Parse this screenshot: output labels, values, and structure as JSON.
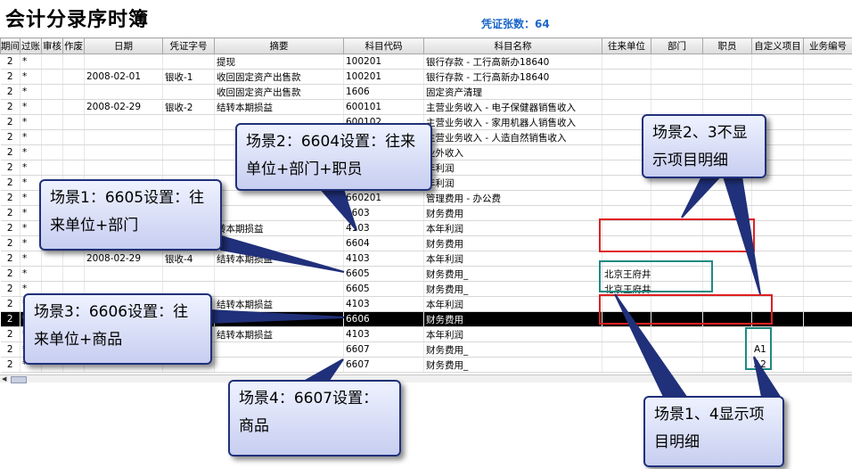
{
  "title": "会计分录序时簿",
  "voucher_count": "凭证张数：64",
  "columns": [
    "期间",
    "过账",
    "审核",
    "作废",
    "日期",
    "凭证字号",
    "摘要",
    "科目代码",
    "科目名称",
    "往来单位",
    "部门",
    "职员",
    "自定义项目",
    "业务编号"
  ],
  "rows": [
    [
      "2",
      "*",
      "",
      "",
      "",
      "",
      "提现",
      "100201",
      "银行存款 - 工行高新办18640",
      "",
      "",
      "",
      "",
      ""
    ],
    [
      "2",
      "*",
      "",
      "",
      "2008-02-01",
      "银收-1",
      "收回固定资产出售款",
      "100201",
      "银行存款 - 工行高新办18640",
      "",
      "",
      "",
      "",
      ""
    ],
    [
      "2",
      "*",
      "",
      "",
      "",
      "",
      "收回固定资产出售款",
      "1606",
      "固定资产清理",
      "",
      "",
      "",
      "",
      ""
    ],
    [
      "2",
      "*",
      "",
      "",
      "2008-02-29",
      "银收-2",
      "结转本期损益",
      "600101",
      "主营业务收入 - 电子保健器销售收入",
      "",
      "",
      "",
      "",
      ""
    ],
    [
      "2",
      "*",
      "",
      "",
      "",
      "",
      "",
      "600102",
      "主营业务收入 - 家用机器人销售收入",
      "",
      "",
      "",
      "",
      ""
    ],
    [
      "2",
      "*",
      "",
      "",
      "",
      "",
      "",
      "600103",
      "主营业务收入 - 人造自然销售收入",
      "",
      "",
      "",
      "",
      ""
    ],
    [
      "2",
      "*",
      "",
      "",
      "",
      "",
      "",
      "",
      "业外收入",
      "",
      "",
      "",
      "",
      ""
    ],
    [
      "2",
      "*",
      "",
      "",
      "",
      "",
      "",
      "",
      "年利润",
      "",
      "",
      "",
      "",
      ""
    ],
    [
      "2",
      "*",
      "",
      "",
      "",
      "",
      "",
      "",
      "年利润",
      "",
      "",
      "",
      "",
      ""
    ],
    [
      "2",
      "*",
      "",
      "",
      "",
      "",
      "",
      "660201",
      "管理费用 - 办公费",
      "",
      "",
      "",
      "",
      ""
    ],
    [
      "2",
      "*",
      "",
      "",
      "",
      "",
      "",
      "6603",
      "财务费用",
      "",
      "",
      "",
      "",
      ""
    ],
    [
      "2",
      "*",
      "",
      "",
      "",
      "",
      "转本期损益",
      "4103",
      "本年利润",
      "",
      "",
      "",
      "",
      ""
    ],
    [
      "2",
      "*",
      "",
      "",
      "",
      "",
      "",
      "6604",
      "财务费用",
      "",
      "",
      "",
      "",
      ""
    ],
    [
      "2",
      "*",
      "",
      "",
      "2008-02-29",
      "银收-4",
      "结转本期损益",
      "4103",
      "本年利润",
      "",
      "",
      "",
      "",
      ""
    ],
    [
      "2",
      "*",
      "",
      "",
      "",
      "",
      "",
      "6605",
      "财务费用_",
      "北京王府井产品推销部",
      "",
      "",
      "",
      ""
    ],
    [
      "2",
      "*",
      "",
      "",
      "",
      "",
      "",
      "6605",
      "财务费用_",
      "北京王府井行政管理部",
      "",
      "",
      "",
      ""
    ],
    [
      "2",
      "*",
      "",
      "",
      "",
      "",
      "结转本期损益",
      "4103",
      "本年利润",
      "",
      "",
      "",
      "",
      ""
    ],
    [
      "2",
      "*",
      "",
      "",
      "",
      "",
      "",
      "6606",
      "财务费用",
      "",
      "",
      "",
      "",
      ""
    ],
    [
      "2",
      "*",
      "",
      "",
      "",
      "",
      "结转本期损益",
      "4103",
      "本年利润",
      "",
      "",
      "",
      "",
      ""
    ],
    [
      "2",
      "*",
      "",
      "",
      "",
      "",
      "",
      "6607",
      "财务费用_",
      "",
      "",
      "",
      "A1",
      ""
    ],
    [
      "2",
      "*",
      "",
      "",
      "",
      "",
      "",
      "6607",
      "财务费用_",
      "",
      "",
      "",
      "A2",
      ""
    ]
  ],
  "selected_row_index": 17,
  "callouts": {
    "scene1": "场景1：6605设置：往来单位+部门",
    "scene2": "场景2：6604设置：往来单位+部门+职员",
    "scene3": "场景3：6606设置：往来单位+商品",
    "scene4": "场景4：6607设置：商品",
    "scene23": "场景2、3不显示项目明细",
    "scene14": "场景1、4显示项目明细"
  },
  "colors": {
    "voucher_text": "#1a66c8",
    "callout_border": "#20307a",
    "highlight_red": "#e02020",
    "highlight_teal": "#1f8a80",
    "selected_row_bg": "#000000"
  }
}
